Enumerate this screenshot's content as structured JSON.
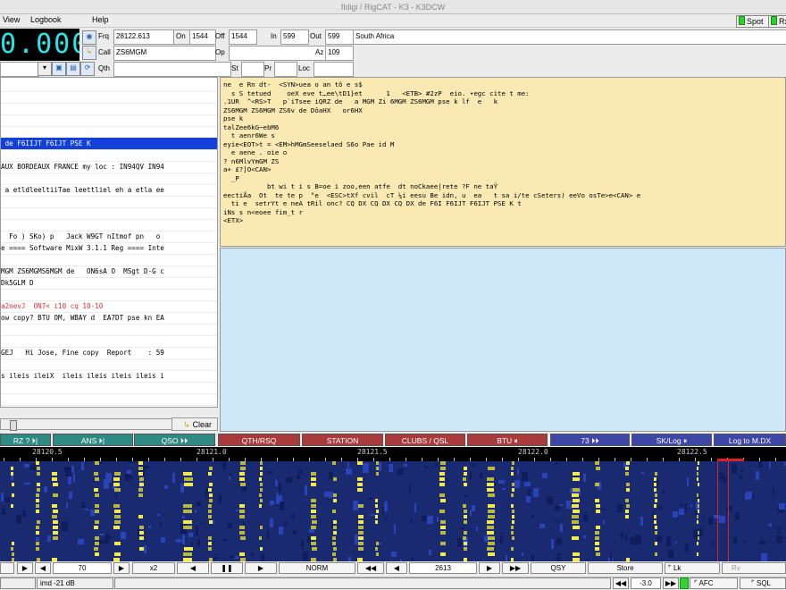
{
  "window": {
    "title": "fldigi / RigCAT - K3 - K3DCW"
  },
  "menu": {
    "view": "View",
    "logbook": "Logbook",
    "help": "Help"
  },
  "indicators": {
    "spot": "Spot",
    "rx": "Rx"
  },
  "freq_display": "0.000",
  "log": {
    "frq_label": "Frq",
    "frq_value": "28122.613",
    "on_label": "On",
    "on_value": "1544",
    "off_label": "Off",
    "off_value": "1544",
    "in_label": "In",
    "in_value": "599",
    "out_label": "Out",
    "out_value": "599",
    "country": "South Africa",
    "call_label": "Call",
    "call_value": "ZS6MGM",
    "op_label": "Op",
    "op_value": "",
    "az_label": "Az",
    "az_value": "109",
    "qth_label": "Qth",
    "qth_value": "",
    "st_label": "St",
    "st_value": "",
    "pr_label": "Pr",
    "pr_value": "",
    "loc_label": "Loc",
    "loc_value": ""
  },
  "rx_lines": [
    {
      "text": "",
      "type": "normal"
    },
    {
      "text": "",
      "type": "normal"
    },
    {
      "text": "",
      "type": "normal"
    },
    {
      "text": "",
      "type": "normal"
    },
    {
      "text": "",
      "type": "normal"
    },
    {
      "text": " de F6IIJT F6IJT PSE K",
      "type": "sel"
    },
    {
      "text": "",
      "type": "normal"
    },
    {
      "text": "AUX BORDEAUX FRANCE my loc : IN94QV IN94",
      "type": "normal"
    },
    {
      "text": "",
      "type": "normal"
    },
    {
      "text": " a etldleeltiiTae leettliel eh a etla ee",
      "type": "normal"
    },
    {
      "text": "",
      "type": "normal"
    },
    {
      "text": "",
      "type": "normal"
    },
    {
      "text": "",
      "type": "normal"
    },
    {
      "text": "  Fo ) SKo) p   Jack W9GT nItmof pn   o",
      "type": "normal"
    },
    {
      "text": "e ==== Software MixW 3.1.1 Reg ==== Inte",
      "type": "normal"
    },
    {
      "text": "",
      "type": "normal"
    },
    {
      "text": "MGM ZS6MGMS6MGM de   ON6sA O  MSgt D-G c",
      "type": "normal"
    },
    {
      "text": "Dk5GLM D",
      "type": "normal"
    },
    {
      "text": "",
      "type": "normal"
    },
    {
      "text": "a2nevJ  ON7< i10 cq 10-10",
      "type": "red"
    },
    {
      "text": "ow copy? BTU OM, WBAY d  EA7DT pse kn EA",
      "type": "normal"
    },
    {
      "text": "",
      "type": "normal"
    },
    {
      "text": "",
      "type": "normal"
    },
    {
      "text": "GEJ   Hi Jose, Fine copy  Report    : 59",
      "type": "normal"
    },
    {
      "text": "",
      "type": "normal"
    },
    {
      "text": "s ileis ileiX  ileis ileis ileis ileis i",
      "type": "normal"
    },
    {
      "text": "",
      "type": "normal"
    },
    {
      "text": "",
      "type": "normal"
    }
  ],
  "tx_lines": [
    "ne  e Rn dt-  <SYN>uea o an tô e s$",
    "  s S tetued    oeX eve t…ee\\tD1}et      1   <ETB> #2zP  eio. •egc cite t me:",
    ".1UR  ^<RS>T   p`iTsee iQRZ de   a MGM Zi 6MGM ZS6MGM pse k lf  e   k",
    "ZS6MGM ZS6MGM ZS6v de DôaHX   or6HX",
    "pse k",
    "talZee6kG~ebM6",
    "  t aenr6We s",
    "eyie<EOT>t = <EM>hMGmSeeselaed S6o Pae id M",
    "  e aene . oie o",
    "? n6MlvYmGM ZS",
    "a+ £?]O<CAN>",
    "  _P",
    "           bt wi t i s B=oe i zoo,een atfe  dt noCkaee|rete ?F ne taŸ",
    "eectiÅa  Ot  te te p  °e  <ESC>tXf cvil  cT ¼i eesu Be idn, u  ea   t sa i/te cSeters) eeVo osTe>e<CAN> e",
    "  ti e  setrYt e neA tRil onc? CQ DX CQ DX CQ DX de F6I F6IJT F6IJT PSE K t",
    "iNs s n<eoee fim_t r",
    "<ETX>"
  ],
  "clear_label": "Clear",
  "macros": [
    {
      "label": "RZ ? ⏵|",
      "color": "teal"
    },
    {
      "label": "ANS ⏵|",
      "color": "teal"
    },
    {
      "label": "QSO ⏵⏵",
      "color": "teal"
    },
    {
      "label": "QTH/RSQ",
      "color": "red"
    },
    {
      "label": "STATION",
      "color": "red"
    },
    {
      "label": "CLUBS / QSL",
      "color": "red"
    },
    {
      "label": "BTU ⏸",
      "color": "red"
    },
    {
      "label": "73 ⏵⏵",
      "color": "blue"
    },
    {
      "label": "SK/Log ⏸",
      "color": "blue"
    },
    {
      "label": "Log to M.DX",
      "color": "blue"
    }
  ],
  "scale_labels": [
    "28120.5",
    "28121.0",
    "28121.5",
    "28122.0",
    "28122.5"
  ],
  "controls": {
    "level": "70",
    "zoom": "x2",
    "mode": "NORM",
    "carrier": "2613",
    "qsy": "QSY",
    "store": "Store",
    "lk": "Lk",
    "rv": "Rv"
  },
  "status": {
    "imd": "imd -21 dB",
    "offset": "-3.0",
    "afc": "AFC",
    "sql": "SQL"
  }
}
